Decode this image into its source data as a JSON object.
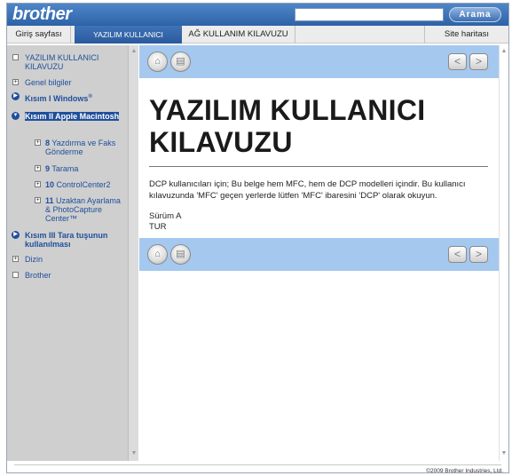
{
  "header": {
    "logo": "brother",
    "search_placeholder": "",
    "search_button": "Arama"
  },
  "nav": {
    "tabs": [
      {
        "label": "Giriş sayfası"
      },
      {
        "label": "YAZILIM KULLANICI KILAVUZU"
      },
      {
        "label": "AĞ KULLANIM KILAVUZU"
      },
      {
        "label": "Site haritası"
      }
    ]
  },
  "sidebar": {
    "items": [
      {
        "label": "YAZILIM KULLANICI KILAVUZU"
      },
      {
        "label": "Genel bilgiler"
      },
      {
        "label": "Kısım I Windows",
        "sup": "®"
      },
      {
        "label": "Kısım II Apple Macintosh"
      },
      {
        "num": "8",
        "label": "Yazdırma ve Faks Gönderme"
      },
      {
        "num": "9",
        "label": "Tarama"
      },
      {
        "num": "10",
        "label": "ControlCenter2"
      },
      {
        "num": "11",
        "label": "Uzaktan Ayarlama & PhotoCapture Center™"
      },
      {
        "label": "Kısım III Tara tuşunun kullanılması"
      },
      {
        "label": "Dizin"
      },
      {
        "label": "Brother"
      }
    ]
  },
  "content": {
    "title": "YAZILIM KULLANICI KILAVUZU",
    "intro": "DCP kullanıcıları için; Bu belge hem MFC, hem de DCP modelleri içindir. Bu kullanıcı kılavuzunda 'MFC' geçen yerlerde lütfen 'MFC' ibaresini 'DCP' olarak okuyun.",
    "version": "Sürüm A",
    "language": "TUR"
  },
  "footer": {
    "copyright": "©2009 Brother Industries, Ltd."
  },
  "colors": {
    "header_blue": "#2d62a7",
    "toolbar_blue": "#a5c8ef",
    "link_blue": "#1f4f9b",
    "sidebar_gray": "#cfcfcf"
  }
}
